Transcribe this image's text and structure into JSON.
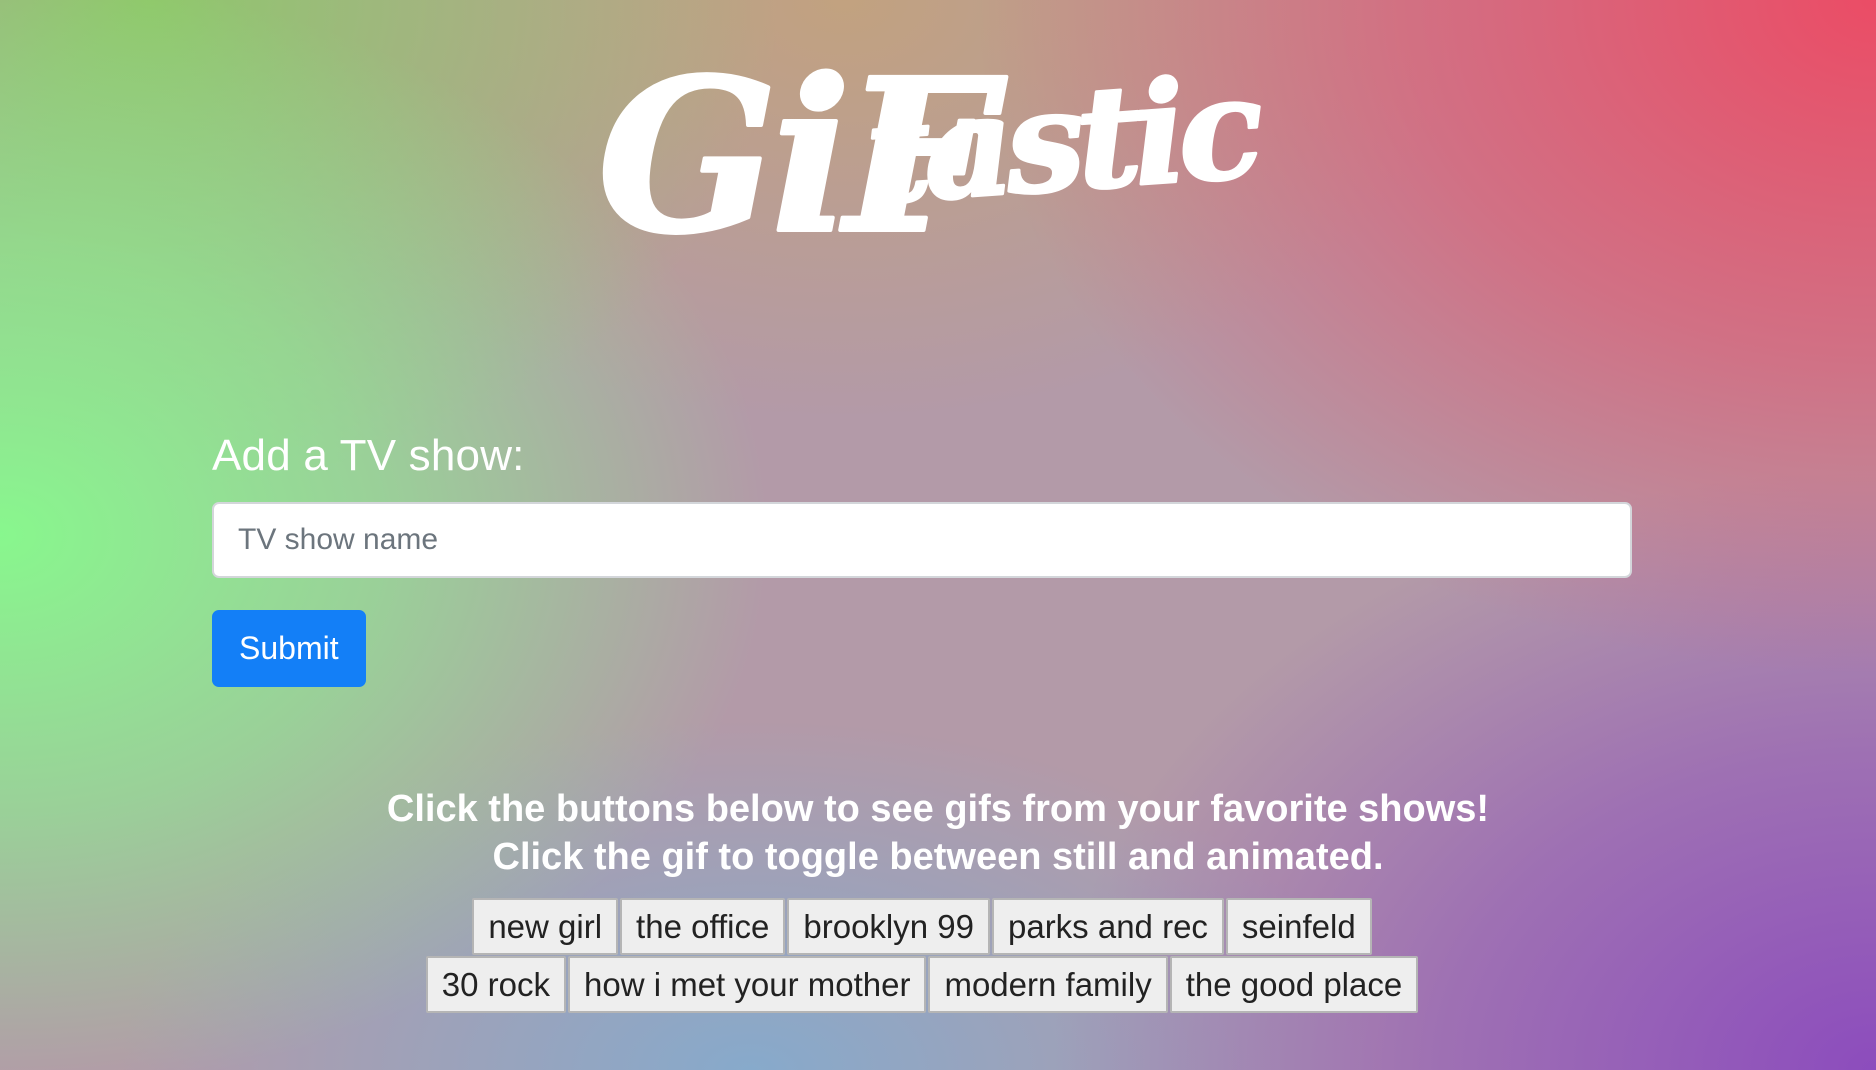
{
  "logo": {
    "text_main": "GiF",
    "text_tail": "tastic"
  },
  "form": {
    "label": "Add a TV show:",
    "input_placeholder": "TV show name",
    "input_value": "",
    "submit_label": "Submit"
  },
  "instructions": {
    "line1": "Click the buttons below to see gifs from your favorite shows!",
    "line2": "Click the gif to toggle between still and animated."
  },
  "shows": [
    "new girl",
    "the office",
    "brooklyn 99",
    "parks and rec",
    "seinfeld",
    "30 rock",
    "how i met your mother",
    "modern family",
    "the good place"
  ],
  "colors": {
    "submit_button": "#137ff7",
    "text": "#ffffff",
    "show_button_bg": "#eeeeee"
  }
}
